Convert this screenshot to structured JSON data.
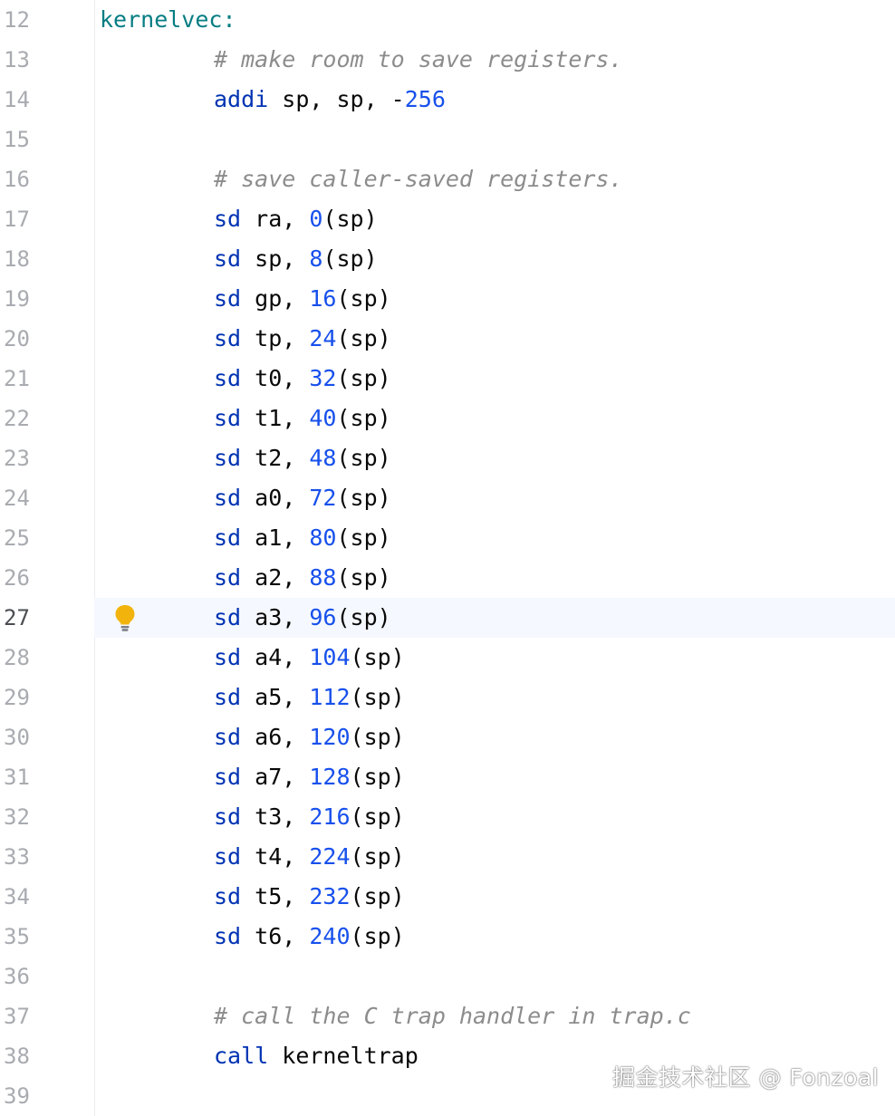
{
  "editor": {
    "lines": [
      {
        "n": "12",
        "tokens": [
          {
            "t": "kernelvec:",
            "c": "label"
          }
        ]
      },
      {
        "n": "13",
        "tokens": [
          {
            "t": "# make room to save registers.",
            "c": "comment"
          }
        ]
      },
      {
        "n": "14",
        "tokens": [
          {
            "t": "addi",
            "c": "kw"
          },
          {
            "t": " sp, sp, -",
            "c": ""
          },
          {
            "t": "256",
            "c": "num"
          }
        ]
      },
      {
        "n": "15",
        "tokens": []
      },
      {
        "n": "16",
        "tokens": [
          {
            "t": "# save caller-saved registers.",
            "c": "comment"
          }
        ]
      },
      {
        "n": "17",
        "tokens": [
          {
            "t": "sd",
            "c": "kw"
          },
          {
            "t": " ra, ",
            "c": ""
          },
          {
            "t": "0",
            "c": "num"
          },
          {
            "t": "(sp)",
            "c": ""
          }
        ]
      },
      {
        "n": "18",
        "tokens": [
          {
            "t": "sd",
            "c": "kw"
          },
          {
            "t": " sp, ",
            "c": ""
          },
          {
            "t": "8",
            "c": "num"
          },
          {
            "t": "(sp)",
            "c": ""
          }
        ]
      },
      {
        "n": "19",
        "tokens": [
          {
            "t": "sd",
            "c": "kw"
          },
          {
            "t": " gp, ",
            "c": ""
          },
          {
            "t": "16",
            "c": "num"
          },
          {
            "t": "(sp)",
            "c": ""
          }
        ]
      },
      {
        "n": "20",
        "tokens": [
          {
            "t": "sd",
            "c": "kw"
          },
          {
            "t": " tp, ",
            "c": ""
          },
          {
            "t": "24",
            "c": "num"
          },
          {
            "t": "(sp)",
            "c": ""
          }
        ]
      },
      {
        "n": "21",
        "tokens": [
          {
            "t": "sd",
            "c": "kw"
          },
          {
            "t": " t0, ",
            "c": ""
          },
          {
            "t": "32",
            "c": "num"
          },
          {
            "t": "(sp)",
            "c": ""
          }
        ]
      },
      {
        "n": "22",
        "tokens": [
          {
            "t": "sd",
            "c": "kw"
          },
          {
            "t": " t1, ",
            "c": ""
          },
          {
            "t": "40",
            "c": "num"
          },
          {
            "t": "(sp)",
            "c": ""
          }
        ]
      },
      {
        "n": "23",
        "tokens": [
          {
            "t": "sd",
            "c": "kw"
          },
          {
            "t": " t2, ",
            "c": ""
          },
          {
            "t": "48",
            "c": "num"
          },
          {
            "t": "(sp)",
            "c": ""
          }
        ]
      },
      {
        "n": "24",
        "tokens": [
          {
            "t": "sd",
            "c": "kw"
          },
          {
            "t": " a0, ",
            "c": ""
          },
          {
            "t": "72",
            "c": "num"
          },
          {
            "t": "(sp)",
            "c": ""
          }
        ]
      },
      {
        "n": "25",
        "tokens": [
          {
            "t": "sd",
            "c": "kw"
          },
          {
            "t": " a1, ",
            "c": ""
          },
          {
            "t": "80",
            "c": "num"
          },
          {
            "t": "(sp)",
            "c": ""
          }
        ]
      },
      {
        "n": "26",
        "tokens": [
          {
            "t": "sd",
            "c": "kw"
          },
          {
            "t": " a2, ",
            "c": ""
          },
          {
            "t": "88",
            "c": "num"
          },
          {
            "t": "(sp)",
            "c": ""
          }
        ]
      },
      {
        "n": "27",
        "current": true,
        "bulb": true,
        "tokens": [
          {
            "t": "sd",
            "c": "kw"
          },
          {
            "t": " a3, ",
            "c": ""
          },
          {
            "t": "96",
            "c": "num"
          },
          {
            "t": "(sp)",
            "c": ""
          }
        ]
      },
      {
        "n": "28",
        "tokens": [
          {
            "t": "sd",
            "c": "kw"
          },
          {
            "t": " a4, ",
            "c": ""
          },
          {
            "t": "104",
            "c": "num"
          },
          {
            "t": "(sp)",
            "c": ""
          }
        ]
      },
      {
        "n": "29",
        "tokens": [
          {
            "t": "sd",
            "c": "kw"
          },
          {
            "t": " a5, ",
            "c": ""
          },
          {
            "t": "112",
            "c": "num"
          },
          {
            "t": "(sp)",
            "c": ""
          }
        ]
      },
      {
        "n": "30",
        "tokens": [
          {
            "t": "sd",
            "c": "kw"
          },
          {
            "t": " a6, ",
            "c": ""
          },
          {
            "t": "120",
            "c": "num"
          },
          {
            "t": "(sp)",
            "c": ""
          }
        ]
      },
      {
        "n": "31",
        "tokens": [
          {
            "t": "sd",
            "c": "kw"
          },
          {
            "t": " a7, ",
            "c": ""
          },
          {
            "t": "128",
            "c": "num"
          },
          {
            "t": "(sp)",
            "c": ""
          }
        ]
      },
      {
        "n": "32",
        "tokens": [
          {
            "t": "sd",
            "c": "kw"
          },
          {
            "t": " t3, ",
            "c": ""
          },
          {
            "t": "216",
            "c": "num"
          },
          {
            "t": "(sp)",
            "c": ""
          }
        ]
      },
      {
        "n": "33",
        "tokens": [
          {
            "t": "sd",
            "c": "kw"
          },
          {
            "t": " t4, ",
            "c": ""
          },
          {
            "t": "224",
            "c": "num"
          },
          {
            "t": "(sp)",
            "c": ""
          }
        ]
      },
      {
        "n": "34",
        "tokens": [
          {
            "t": "sd",
            "c": "kw"
          },
          {
            "t": " t5, ",
            "c": ""
          },
          {
            "t": "232",
            "c": "num"
          },
          {
            "t": "(sp)",
            "c": ""
          }
        ]
      },
      {
        "n": "35",
        "tokens": [
          {
            "t": "sd",
            "c": "kw"
          },
          {
            "t": " t6, ",
            "c": ""
          },
          {
            "t": "240",
            "c": "num"
          },
          {
            "t": "(sp)",
            "c": ""
          }
        ]
      },
      {
        "n": "36",
        "tokens": []
      },
      {
        "n": "37",
        "tokens": [
          {
            "t": "# call the C trap handler in trap.c",
            "c": "comment"
          }
        ]
      },
      {
        "n": "38",
        "tokens": [
          {
            "t": "call",
            "c": "kw"
          },
          {
            "t": " kerneltrap",
            "c": ""
          }
        ]
      },
      {
        "n": "39",
        "tokens": []
      }
    ],
    "intention_icon": "lightbulb-icon",
    "colors": {
      "label": "#067d83",
      "comment": "#8c8c8c",
      "keyword": "#0033b3",
      "number": "#1750eb",
      "current_line": "#f5f8fe"
    }
  },
  "watermark": "掘金技术社区 @ Fonzoal"
}
